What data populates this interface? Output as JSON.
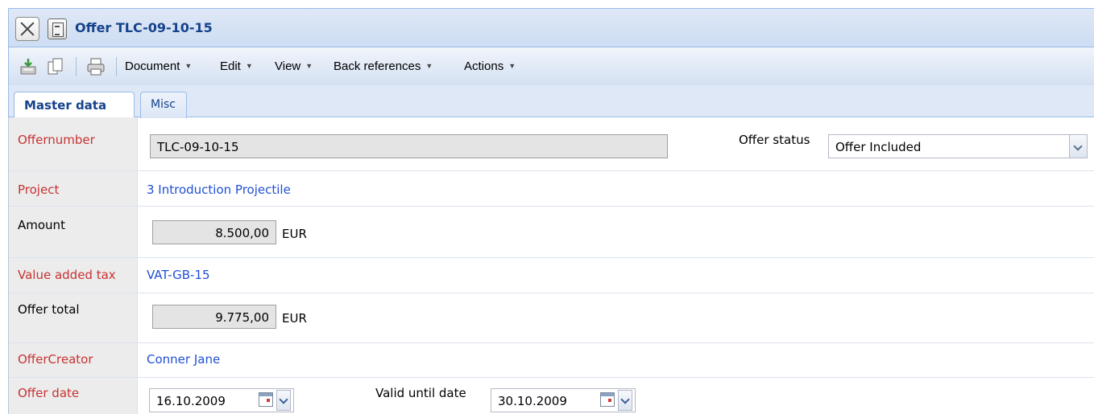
{
  "window": {
    "title": "Offer TLC-09-10-15",
    "close_icon": "close-icon",
    "doc_icon": "document-icon"
  },
  "toolbar": {
    "icons": [
      "save-icon",
      "copy-icon",
      "print-icon"
    ],
    "menus": {
      "document": "Document",
      "edit": "Edit",
      "view": "View",
      "back_references": "Back references",
      "actions": "Actions"
    }
  },
  "tabs": {
    "master_data": "Master data",
    "misc": "Misc"
  },
  "form": {
    "offernumber": {
      "label": "Offernumber",
      "value": "TLC-09-10-15"
    },
    "offer_status": {
      "label": "Offer status",
      "value": "Offer Included"
    },
    "project": {
      "label": "Project",
      "value": "3 Introduction Projectile"
    },
    "amount": {
      "label": "Amount",
      "value": "8.500,00",
      "currency": "EUR"
    },
    "vat": {
      "label": "Value added tax",
      "value": "VAT-GB-15"
    },
    "offer_total": {
      "label": "Offer total",
      "value": "9.775,00",
      "currency": "EUR"
    },
    "offer_creator": {
      "label": "OfferCreator",
      "value": "Conner Jane"
    },
    "offer_date": {
      "label": "Offer date",
      "value": "16.10.2009"
    },
    "valid_until": {
      "label": "Valid until date",
      "value": "30.10.2009"
    }
  },
  "colors": {
    "required_label": "#c83232",
    "link": "#1f4fd6",
    "title": "#15428b"
  }
}
